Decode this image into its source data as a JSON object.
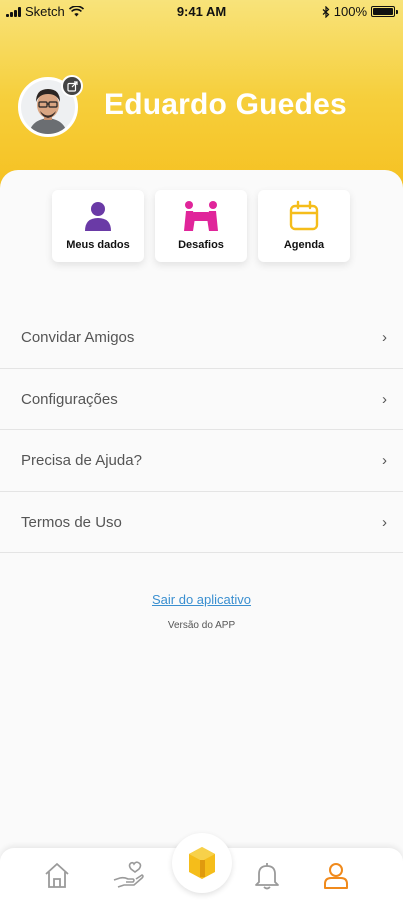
{
  "status_bar": {
    "carrier": "Sketch",
    "time": "9:41 AM",
    "battery": "100%"
  },
  "profile": {
    "name": "Eduardo Guedes"
  },
  "quick_actions": [
    {
      "label": "Meus dados",
      "icon": "person-icon",
      "color": "#6a3aa6"
    },
    {
      "label": "Desafios",
      "icon": "challenge-icon",
      "color": "#e0259a"
    },
    {
      "label": "Agenda",
      "icon": "calendar-icon",
      "color": "#f5bd1a"
    }
  ],
  "menu": [
    {
      "label": "Convidar Amigos"
    },
    {
      "label": "Configurações"
    },
    {
      "label": "Precisa de Ajuda?"
    },
    {
      "label": "Termos de Uso"
    }
  ],
  "footer": {
    "logout": "Sair do aplicativo",
    "version": "Versão do APP"
  },
  "tabbar": {
    "items": [
      "home-icon",
      "heart-hand-icon",
      "app-logo-icon",
      "bell-icon",
      "profile-icon"
    ],
    "active": "profile-icon",
    "accent": "#f08a1c"
  }
}
